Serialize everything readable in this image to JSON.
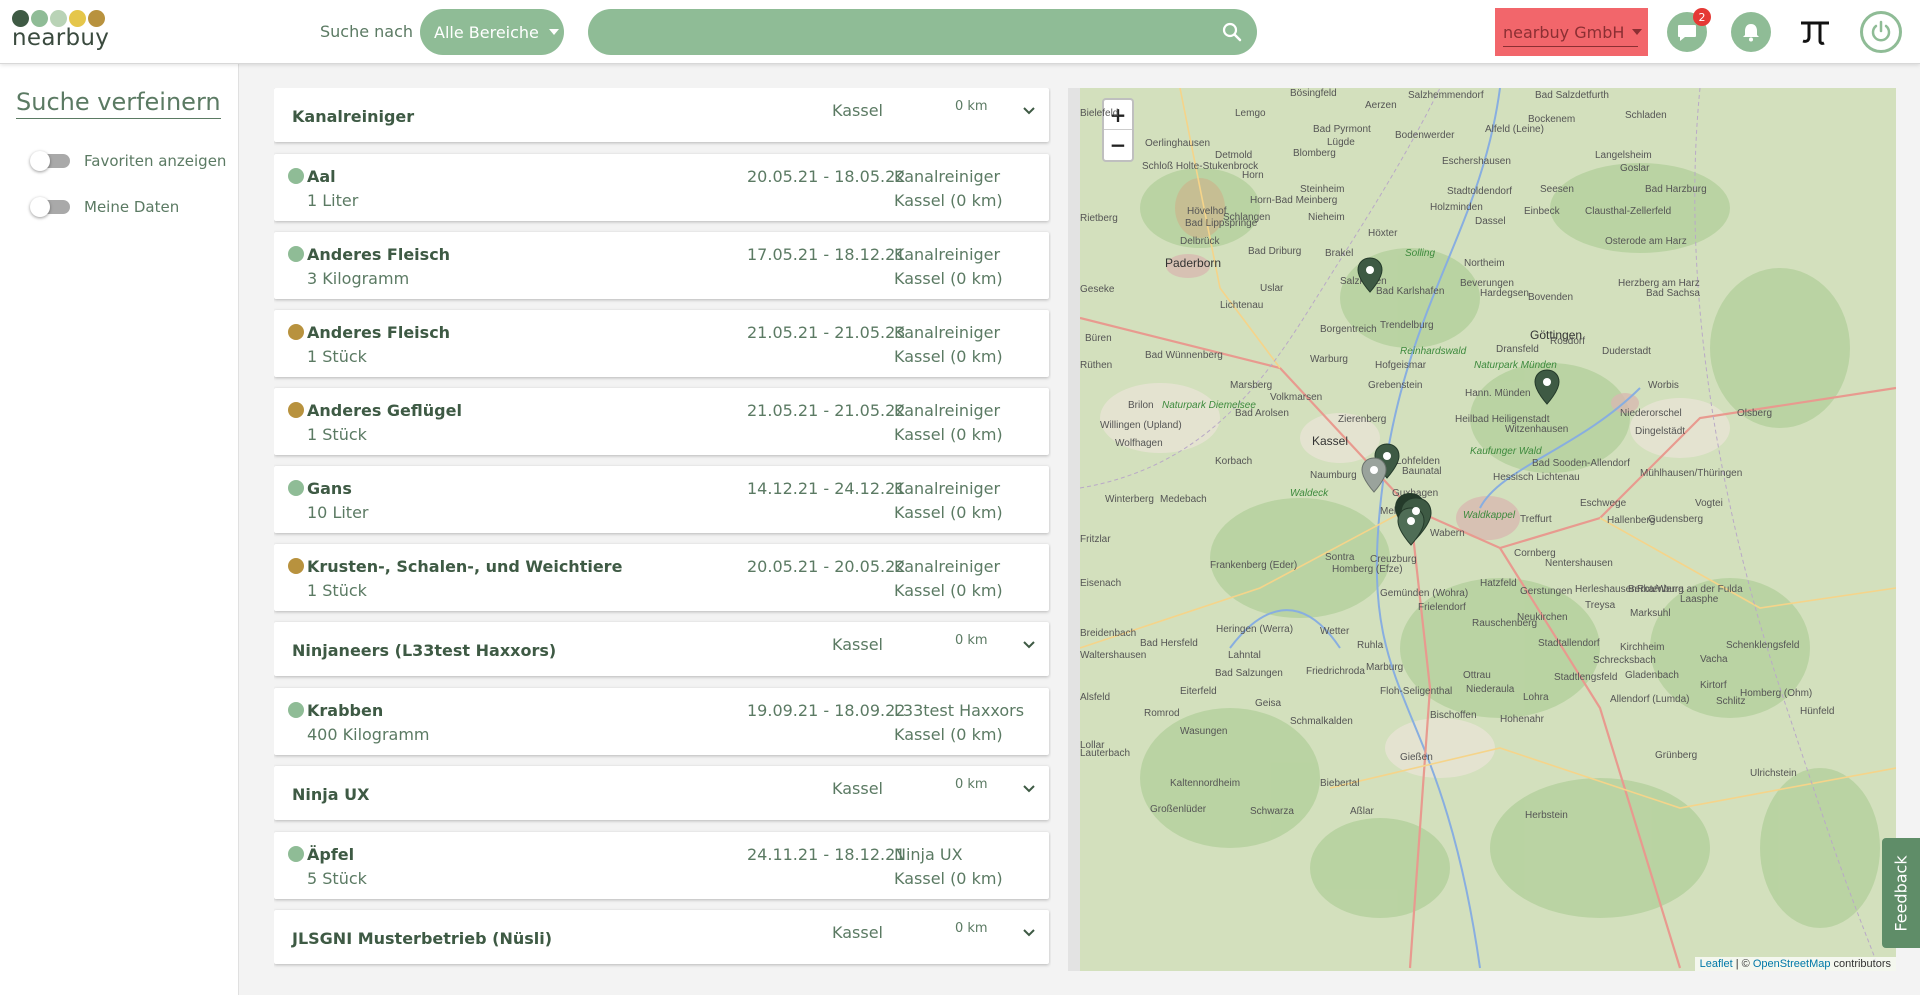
{
  "header": {
    "logo_text": "nearbuy",
    "search_prefix": "Suche nach",
    "area_selector": "Alle Bereiche",
    "search_placeholder": "",
    "company": "nearbuy GmbH",
    "messages_badge": "2",
    "brand_mark": "JT",
    "colors": {
      "accent": "#8fbc96",
      "company_bg": "#f2666b",
      "dark_green": "#3e5a44",
      "gold": "#b8923e"
    }
  },
  "sidebar": {
    "title": "Suche verfeinern",
    "toggles": [
      {
        "label": "Favoriten anzeigen",
        "on": false
      },
      {
        "label": "Meine Daten",
        "on": false
      }
    ]
  },
  "list": {
    "groups": [
      {
        "name": "Kanalreiniger",
        "city": "Kassel",
        "distance": "0 km"
      },
      {
        "name": "Ninjaneers (L33test Haxxors)",
        "city": "Kassel",
        "distance": "0 km"
      },
      {
        "name": "Ninja UX",
        "city": "Kassel",
        "distance": "0 km"
      },
      {
        "name": "JLSGNI Musterbetrieb (Nüsli)",
        "city": "Kassel",
        "distance": "0 km"
      }
    ],
    "items": [
      {
        "name": "Aal",
        "qty": "1 Liter",
        "dates": "20.05.21 - 18.05.22",
        "provider": "Kanalreiniger",
        "location": "Kassel (0 km)",
        "status_color": "#8fbc96"
      },
      {
        "name": "Anderes Fleisch",
        "qty": "3 Kilogramm",
        "dates": "17.05.21 - 18.12.21",
        "provider": "Kanalreiniger",
        "location": "Kassel (0 km)",
        "status_color": "#8fbc96"
      },
      {
        "name": "Anderes Fleisch",
        "qty": "1 Stück",
        "dates": "21.05.21 - 21.05.23",
        "provider": "Kanalreiniger",
        "location": "Kassel (0 km)",
        "status_color": "#b8923e"
      },
      {
        "name": "Anderes Geflügel",
        "qty": "1 Stück",
        "dates": "21.05.21 - 21.05.22",
        "provider": "Kanalreiniger",
        "location": "Kassel (0 km)",
        "status_color": "#b8923e"
      },
      {
        "name": "Gans",
        "qty": "10 Liter",
        "dates": "14.12.21 - 24.12.21",
        "provider": "Kanalreiniger",
        "location": "Kassel (0 km)",
        "status_color": "#8fbc96"
      },
      {
        "name": "Krusten-, Schalen-, und Weichtiere",
        "qty": "1 Stück",
        "dates": "20.05.21 - 20.05.22",
        "provider": "Kanalreiniger",
        "location": "Kassel (0 km)",
        "status_color": "#b8923e"
      },
      {
        "name": "Krabben",
        "qty": "400 Kilogramm",
        "dates": "19.09.21 - 18.09.22",
        "provider": "L33test Haxxors",
        "location": "Kassel (0 km)",
        "status_color": "#8fbc96"
      },
      {
        "name": "Äpfel",
        "qty": "5 Stück",
        "dates": "24.11.21 - 18.12.21",
        "provider": "Ninja UX",
        "location": "Kassel (0 km)",
        "status_color": "#8fbc96"
      }
    ]
  },
  "map": {
    "zoom_in": "+",
    "zoom_out": "−",
    "attribution_leaflet": "Leaflet",
    "attribution_sep": " | © ",
    "attribution_osm": "OpenStreetMap",
    "attribution_suffix": " contributors",
    "places": [
      "Bösingfeld",
      "Aerzen",
      "Salzhemmendorf",
      "Bad Salzdetfurth",
      "Bielefeld",
      "Lemgo",
      "Bad Pyrmont",
      "Lügde",
      "Bodenwerder",
      "Alfeld (Leine)",
      "Bockenem",
      "Schladen",
      "Oerlinghausen",
      "Detmold",
      "Blomberg",
      "Eschershausen",
      "Langelsheim",
      "Goslar",
      "Schloß Holte-Stukenbrock",
      "Horn",
      "Steinheim",
      "Stadtoldendorf",
      "Seesen",
      "Bad Harzburg",
      "Horn-Bad Meinberg",
      "Holzminden",
      "Einbeck",
      "Hövelhof",
      "Schlangen",
      "Nieheim",
      "Dassel",
      "Clausthal-Zellerfeld",
      "Rietberg",
      "Bad Lippspringe",
      "Höxter",
      "Delbrück",
      "Bad Driburg",
      "Brakel",
      "Solling",
      "Osterode am Harz",
      "Paderborn",
      "Northeim",
      "Salzkotten",
      "Beverungen",
      "Uslar",
      "Herzberg am Harz",
      "Geseke",
      "Bad Karlshafen",
      "Hardegsen",
      "Lichtenau",
      "Bovenden",
      "Bad Sachsa",
      "Büren",
      "Borgentreich",
      "Trendelburg",
      "Göttingen",
      "Bad Wünnenberg",
      "Reinhardswald",
      "Rosdorf",
      "Duderstadt",
      "Rüthen",
      "Warburg",
      "Hofgeismar",
      "Dransfeld",
      "Naturpark Münden",
      "Marsberg",
      "Grebenstein",
      "Hann. Münden",
      "Worbis",
      "Brilon",
      "Volkmarsen",
      "Naturpark Diemelsee",
      "Bad Arolsen",
      "Zierenberg",
      "Heilbad Heiligenstadt",
      "Niederorschel",
      "Olsberg",
      "Willingen (Upland)",
      "Wolfhagen",
      "Kassel",
      "Witzenhausen",
      "Dingelstädt",
      "Korbach",
      "Lohfelden",
      "Kaufunger Wald",
      "Bad Sooden-Allendorf",
      "Naumburg",
      "Baunatal",
      "Hessisch Lichtenau",
      "Mühlhausen/Thüringen",
      "Winterberg",
      "Medebach",
      "Waldeck",
      "Guxhagen",
      "Eschwege",
      "Vogtei",
      "Gudensberg",
      "Melsungen",
      "Waldkappel",
      "Treffurt",
      "Hallenberg",
      "Fritzlar",
      "Wabern",
      "Sontra",
      "Creuzburg",
      "Frankenberg (Eder)",
      "Homberg (Efze)",
      "Cornberg",
      "Nentershausen",
      "Herleshausen",
      "Rotenburg an der Fulda",
      "Eisenach",
      "Hatzfeld",
      "Gemünden (Wohra)",
      "Frielendorf",
      "Gerstungen",
      "Berka/Werra",
      "Laasphe",
      "Treysa",
      "Marksuhl",
      "Breidenbach",
      "Wetter",
      "Rauschenberg",
      "Neukirchen",
      "Bad Hersfeld",
      "Heringen (Werra)",
      "Ruhla",
      "Waltershausen",
      "Lahntal",
      "Stadtallendorf",
      "Schrecksbach",
      "Kirchheim",
      "Schenklengsfeld",
      "Vacha",
      "Bad Salzungen",
      "Friedrichroda",
      "Marburg",
      "Ottrau",
      "Niederaula",
      "Stadtlengsfeld",
      "Gladenbach",
      "Kirtorf",
      "Alsfeld",
      "Eiterfeld",
      "Floh-Seligenthal",
      "Lohra",
      "Homberg (Ohm)",
      "Romrod",
      "Geisa",
      "Schmalkalden",
      "Bischoffen",
      "Allendorf (Lumda)",
      "Schlitz",
      "Hünfeld",
      "Wasungen",
      "Hohenahr",
      "Lollar",
      "Lauterbach",
      "Kaltennordheim",
      "Biebertal",
      "Gießen",
      "Grünberg",
      "Ulrichstein",
      "Großenlüder",
      "Schwarza",
      "Aßlar",
      "Herbstein"
    ]
  },
  "feedback_label": "Feedback"
}
